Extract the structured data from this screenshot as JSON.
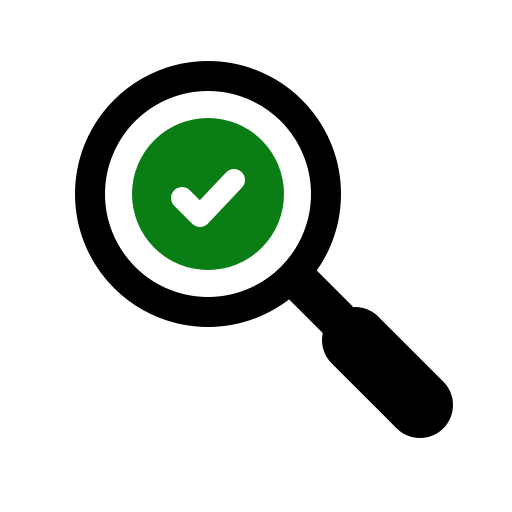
{
  "icon": {
    "name": "magnifier-check-icon",
    "parts": {
      "magnifier": "magnifying-glass-icon",
      "check": "checkmark-icon"
    },
    "colors": {
      "background": "#ffffff",
      "outline": "#000000",
      "check_fill": "#0a7d14",
      "check_mark": "#ffffff"
    }
  }
}
